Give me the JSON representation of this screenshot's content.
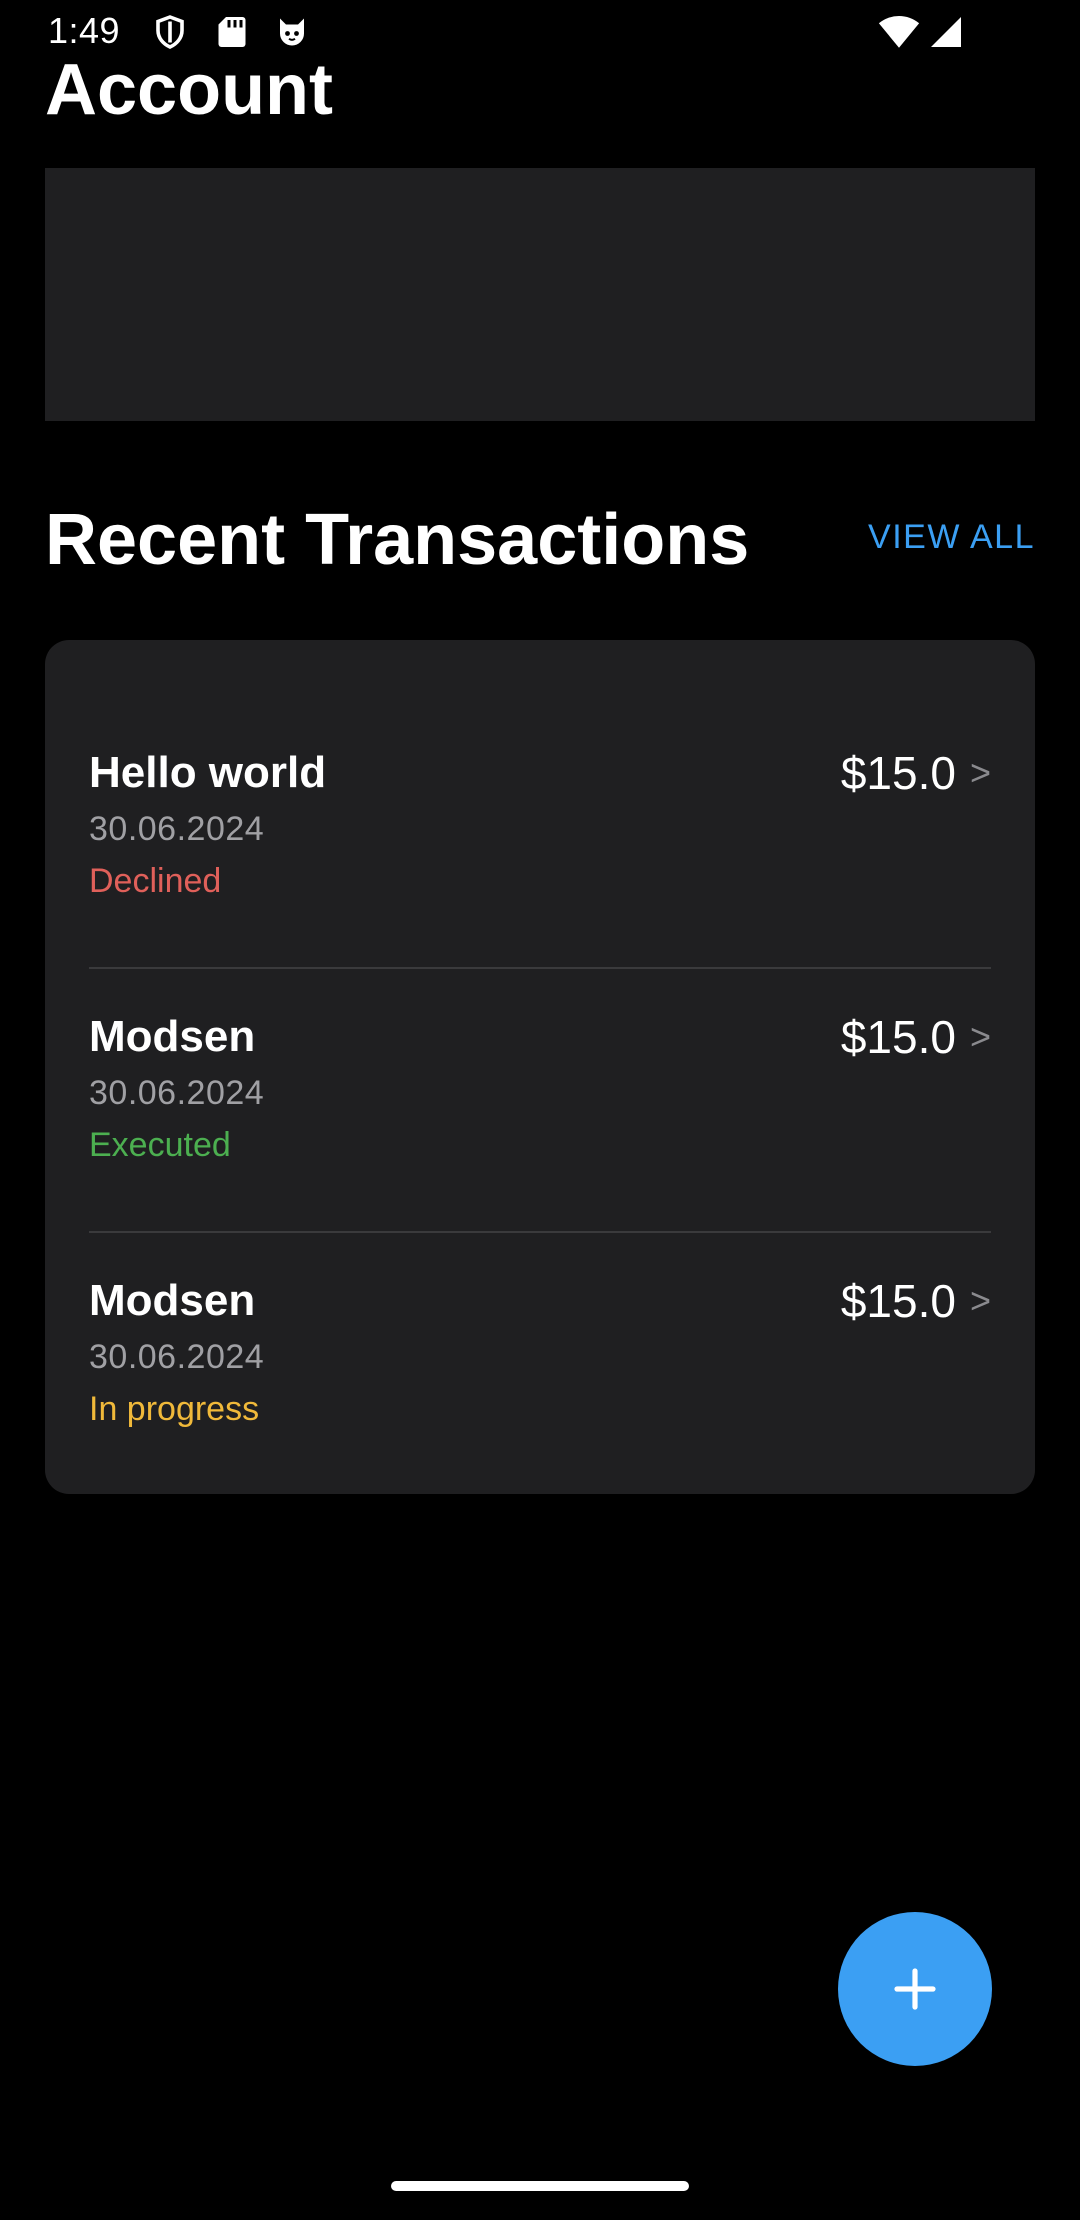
{
  "status_bar": {
    "time": "1:49",
    "left_icons": [
      "shield-icon",
      "sd-card-icon",
      "cat-face-icon"
    ],
    "right_icons": [
      "wifi-icon",
      "signal-icon"
    ]
  },
  "page": {
    "title": "Account"
  },
  "transactions_section": {
    "title": "Recent Transactions",
    "view_all_label": "VIEW ALL",
    "items": [
      {
        "name": "Hello world",
        "date": "30.06.2024",
        "status": "Declined",
        "status_color": "#e0605a",
        "amount": "$15.0",
        "chevron": ">"
      },
      {
        "name": "Modsen",
        "date": "30.06.2024",
        "status": "Executed",
        "status_color": "#4caf50",
        "amount": "$15.0",
        "chevron": ">"
      },
      {
        "name": "Modsen",
        "date": "30.06.2024",
        "status": "In progress",
        "status_color": "#f0b93a",
        "amount": "$15.0",
        "chevron": ">"
      }
    ]
  },
  "fab": {
    "icon": "plus-icon"
  },
  "colors": {
    "background": "#000000",
    "surface": "#1f1f21",
    "accent": "#3b9ff3"
  }
}
